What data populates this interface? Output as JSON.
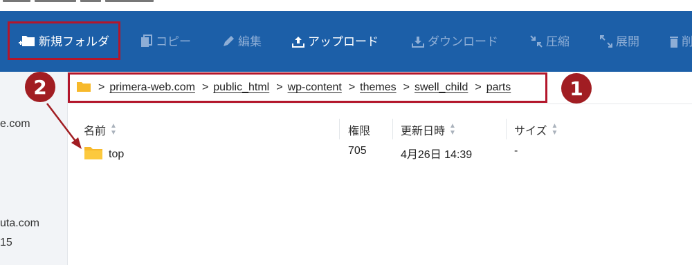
{
  "toolbar": {
    "buttons": [
      {
        "label": "新規フォルダ",
        "state": "active",
        "icon": "new-folder-icon"
      },
      {
        "label": "コピー",
        "state": "disabled",
        "icon": "copy-icon"
      },
      {
        "label": "編集",
        "state": "disabled",
        "icon": "pencil-icon"
      },
      {
        "label": "アップロード",
        "state": "active",
        "icon": "upload-icon"
      },
      {
        "label": "ダウンロード",
        "state": "disabled",
        "icon": "download-icon"
      },
      {
        "label": "圧縮",
        "state": "disabled",
        "icon": "compress-icon"
      },
      {
        "label": "展開",
        "state": "disabled",
        "icon": "expand-icon"
      },
      {
        "label": "削",
        "state": "disabled",
        "icon": "trash-icon"
      }
    ]
  },
  "sidebar": {
    "texts": [
      "e.com",
      "uta.com",
      "15"
    ]
  },
  "breadcrumb": {
    "items": [
      "primera-web.com",
      "public_html",
      "wp-content",
      "themes",
      "swell_child",
      "parts"
    ]
  },
  "annotations": {
    "badge_1": "1",
    "badge_2": "2"
  },
  "table": {
    "headers": {
      "name": "名前",
      "permission": "権限",
      "modified": "更新日時",
      "size": "サイズ"
    },
    "rows": [
      {
        "name": "top",
        "permission": "705",
        "modified": "4月26日 14:39",
        "size": "-"
      }
    ]
  },
  "colors": {
    "toolbar_bg": "#1c5fa8",
    "annotation_red": "#b3162b",
    "folder_yellow": "#f7b92b"
  }
}
